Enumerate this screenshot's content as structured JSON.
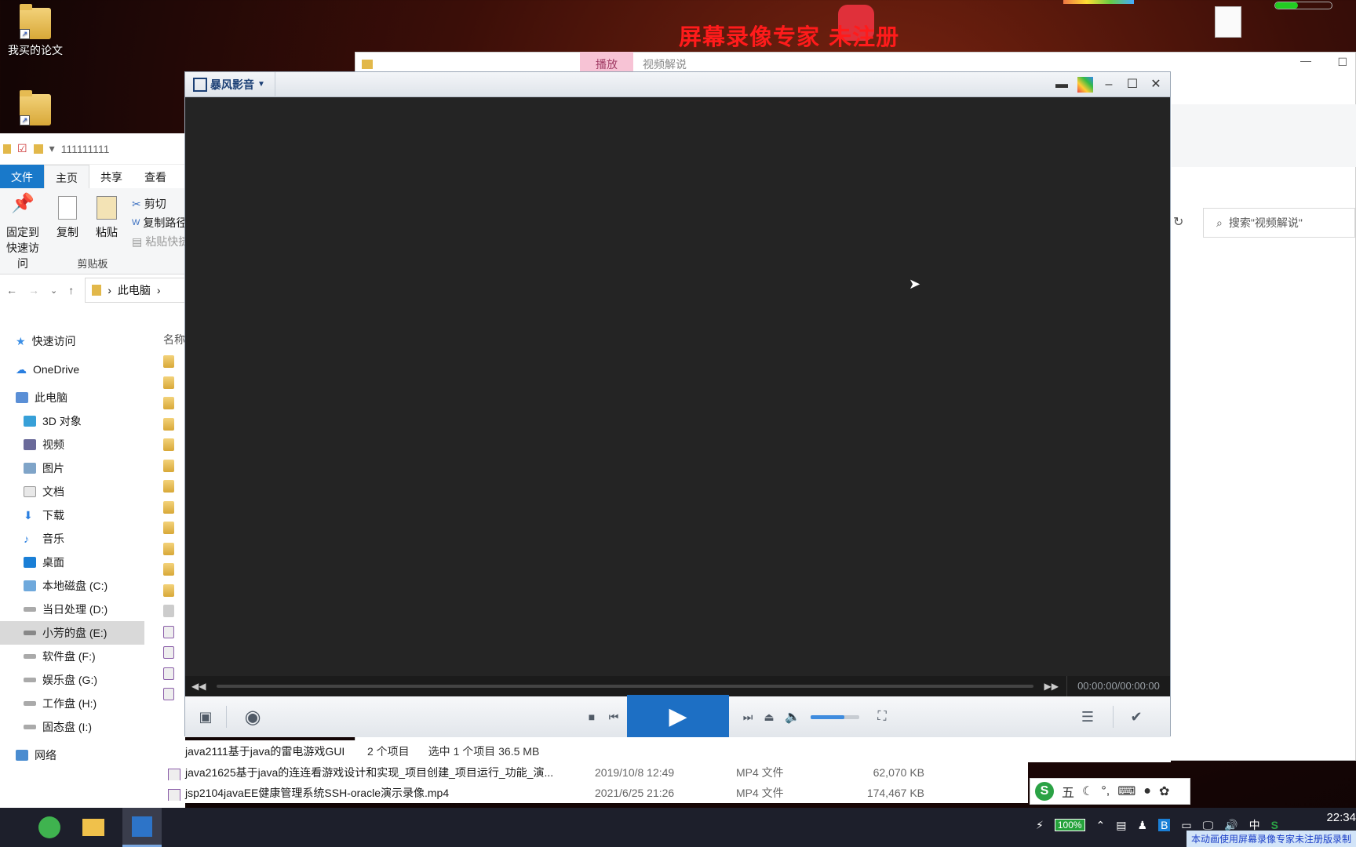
{
  "desktop": {
    "icons": [
      {
        "label": "我买的论文"
      }
    ],
    "watermark": "屏幕录像专家 未注册",
    "partial_labels": {
      "shortcut_top": "",
      "new_doc": ""
    }
  },
  "explorer": {
    "path_title": "111111111",
    "tabs": {
      "file": "文件",
      "home": "主页",
      "share": "共享",
      "view": "查看"
    },
    "ribbon": {
      "pin": "固定到\n快速访问",
      "pin_line1": "固定到",
      "pin_line2": "快速访问",
      "copy": "复制",
      "paste": "粘贴",
      "cut": "剪切",
      "copy_path": "复制路径",
      "paste_shortcut": "粘贴快捷方式",
      "group": "剪贴板"
    },
    "address": {
      "location": "此电脑"
    },
    "nav": {
      "quick_access": "快速访问",
      "onedrive": "OneDrive",
      "this_pc": "此电脑",
      "objects3d": "3D 对象",
      "videos": "视频",
      "pictures": "图片",
      "documents": "文档",
      "downloads": "下载",
      "music": "音乐",
      "desktop": "桌面",
      "drive_c": "本地磁盘 (C:)",
      "drive_d": "当日处理 (D:)",
      "drive_e": "小芳的盘 (E:)",
      "drive_f": "软件盘 (F:)",
      "drive_g": "娱乐盘 (G:)",
      "drive_h": "工作盘 (H:)",
      "drive_i": "固态盘 (I:)",
      "network": "网络"
    },
    "column_name": "名称"
  },
  "right_window": {
    "play_tab": "播放",
    "title": "视频解说",
    "search_placeholder": "搜索\"视频解说\""
  },
  "player": {
    "app_name": "暴风影音",
    "time": "00:00:00/00:00:00",
    "volume_level": 0.7,
    "progress": 0
  },
  "status": {
    "item_count": "2 个项目",
    "selected": "选中 1 个项目  36.5 MB"
  },
  "files": [
    {
      "name": "java2111基于java的雷电游戏GUI",
      "date": "",
      "type": "",
      "size": ""
    },
    {
      "name": "java21625基于java的连连看游戏设计和实现_项目创建_项目运行_功能_演...",
      "date": "2019/10/8 12:49",
      "type": "MP4 文件",
      "size": "62,070 KB"
    },
    {
      "name": "jsp2104javaEE健康管理系统SSH-oracle演示录像.mp4",
      "date": "2021/6/25 21:26",
      "type": "MP4 文件",
      "size": "174,467 KB"
    }
  ],
  "ime": {
    "mode": "五",
    "lang": "中"
  },
  "taskbar": {
    "battery": "100%",
    "clock": "22:34",
    "register_note": "本动画使用屏幕录像专家未注册版录制"
  }
}
